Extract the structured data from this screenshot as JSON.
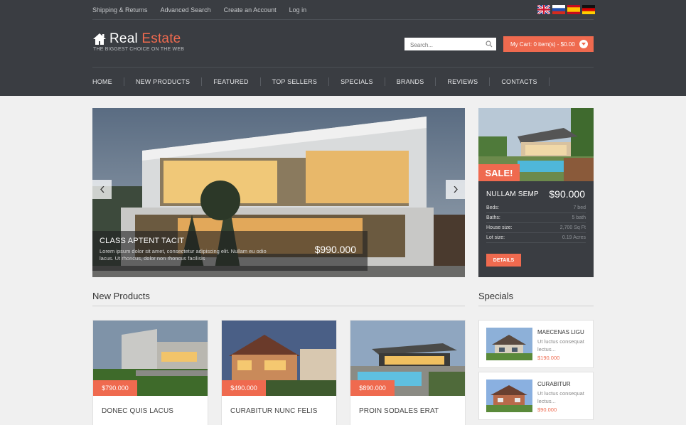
{
  "top_links": [
    "Shipping & Returns",
    "Advanced Search",
    "Create an Account",
    "Log in"
  ],
  "brand": {
    "name_part1": "Real",
    "name_part2": "Estate",
    "tagline": "THE BIGGEST CHOICE ON THE WEB"
  },
  "search": {
    "placeholder": "Search..."
  },
  "cart": {
    "label": "My Cart: 0 item(s) - $0.00"
  },
  "nav": [
    "HOME",
    "NEW PRODUCTS",
    "FEATURED",
    "TOP SELLERS",
    "SPECIALS",
    "BRANDS",
    "REVIEWS",
    "CONTACTS"
  ],
  "slider": {
    "title": "CLASS APTENT TACIT",
    "text": "Lorem ipsum dolor sit amet, consectetur adipiscing elit. Nullam eu odio lacus. Ut rhoncus, dolor non rhoncus facilisis",
    "price": "$990.000"
  },
  "sale": {
    "badge": "SALE!",
    "name": "NULLAM SEMP",
    "price": "$90.000",
    "specs": [
      {
        "label": "Beds:",
        "value": "7 bed"
      },
      {
        "label": "Baths:",
        "value": "5 bath"
      },
      {
        "label": "House size:",
        "value": "2,700 Sq Ft"
      },
      {
        "label": "Lot size:",
        "value": "0.19 Acres"
      }
    ],
    "details_label": "DETAILS"
  },
  "new_products": {
    "title": "New Products",
    "items": [
      {
        "price": "$790.000",
        "name": "DONEC QUIS LACUS"
      },
      {
        "price": "$490.000",
        "name": "CURABITUR NUNC FELIS"
      },
      {
        "price": "$890.000",
        "name": "PROIN SODALES ERAT"
      }
    ]
  },
  "specials": {
    "title": "Specials",
    "items": [
      {
        "name": "MAECENAS LIGU",
        "desc": "Ut luctus consequat lectus...",
        "price": "$190.000"
      },
      {
        "name": "CURABITUR",
        "desc": "Ut luctus consequat lectus...",
        "price": "$90.000"
      }
    ]
  },
  "colors": {
    "header_bg": "#3a3d42",
    "accent": "#ef6a4f",
    "page_bg": "#f0f0f0"
  }
}
